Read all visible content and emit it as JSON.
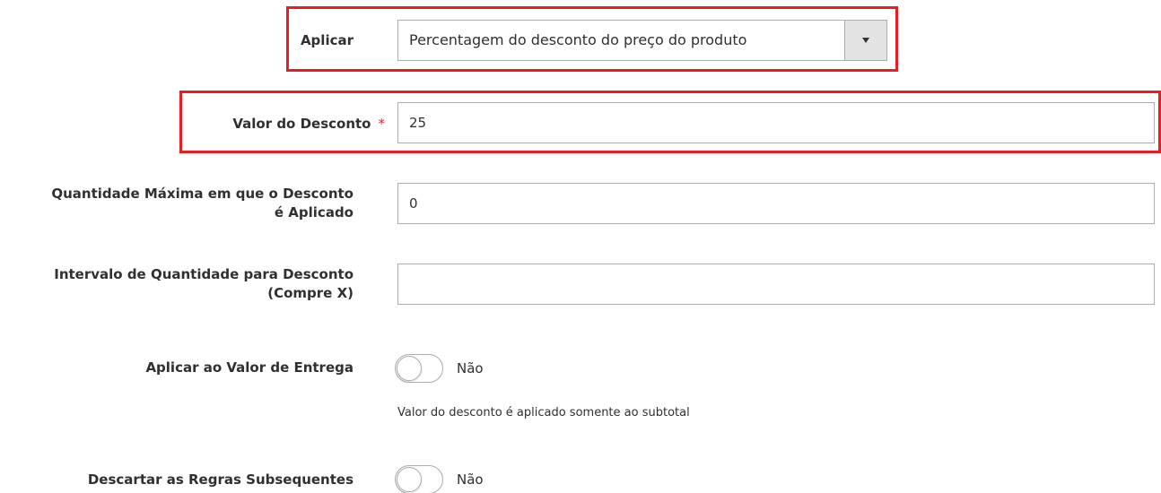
{
  "form": {
    "apply": {
      "label": "Aplicar",
      "selected": "Percentagem do desconto do preço do produto"
    },
    "discount_amount": {
      "label": "Valor do Desconto",
      "required_mark": "*",
      "value": "25"
    },
    "max_qty": {
      "label_line1": "Quantidade Máxima em que o Desconto",
      "label_line2": "é Aplicado",
      "value": "0"
    },
    "discount_step": {
      "label_line1": "Intervalo de Quantidade para Desconto",
      "label_line2": "(Compre X)",
      "value": ""
    },
    "apply_to_shipping": {
      "label": "Aplicar ao Valor de Entrega",
      "toggle_text": "Não",
      "note": "Valor do desconto é aplicado somente ao subtotal"
    },
    "discard_subsequent": {
      "label": "Descartar as Regras Subsequentes",
      "toggle_text": "Não"
    }
  },
  "colors": {
    "highlight": "#ec1c24",
    "required": "#e22626",
    "border": "#adadad"
  }
}
